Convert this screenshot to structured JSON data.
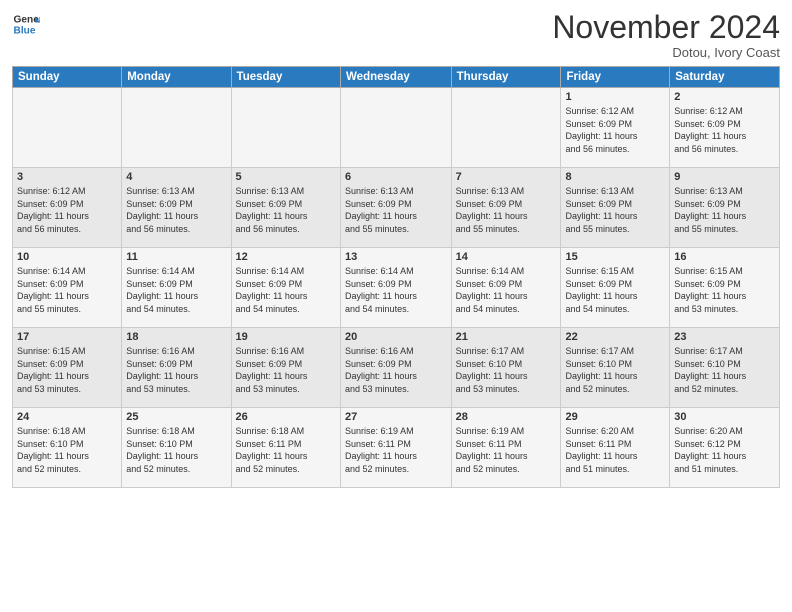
{
  "header": {
    "logo_line1": "General",
    "logo_line2": "Blue",
    "month_title": "November 2024",
    "location": "Dotou, Ivory Coast"
  },
  "weekdays": [
    "Sunday",
    "Monday",
    "Tuesday",
    "Wednesday",
    "Thursday",
    "Friday",
    "Saturday"
  ],
  "weeks": [
    [
      {
        "day": "",
        "info": ""
      },
      {
        "day": "",
        "info": ""
      },
      {
        "day": "",
        "info": ""
      },
      {
        "day": "",
        "info": ""
      },
      {
        "day": "",
        "info": ""
      },
      {
        "day": "1",
        "info": "Sunrise: 6:12 AM\nSunset: 6:09 PM\nDaylight: 11 hours\nand 56 minutes."
      },
      {
        "day": "2",
        "info": "Sunrise: 6:12 AM\nSunset: 6:09 PM\nDaylight: 11 hours\nand 56 minutes."
      }
    ],
    [
      {
        "day": "3",
        "info": "Sunrise: 6:12 AM\nSunset: 6:09 PM\nDaylight: 11 hours\nand 56 minutes."
      },
      {
        "day": "4",
        "info": "Sunrise: 6:13 AM\nSunset: 6:09 PM\nDaylight: 11 hours\nand 56 minutes."
      },
      {
        "day": "5",
        "info": "Sunrise: 6:13 AM\nSunset: 6:09 PM\nDaylight: 11 hours\nand 56 minutes."
      },
      {
        "day": "6",
        "info": "Sunrise: 6:13 AM\nSunset: 6:09 PM\nDaylight: 11 hours\nand 55 minutes."
      },
      {
        "day": "7",
        "info": "Sunrise: 6:13 AM\nSunset: 6:09 PM\nDaylight: 11 hours\nand 55 minutes."
      },
      {
        "day": "8",
        "info": "Sunrise: 6:13 AM\nSunset: 6:09 PM\nDaylight: 11 hours\nand 55 minutes."
      },
      {
        "day": "9",
        "info": "Sunrise: 6:13 AM\nSunset: 6:09 PM\nDaylight: 11 hours\nand 55 minutes."
      }
    ],
    [
      {
        "day": "10",
        "info": "Sunrise: 6:14 AM\nSunset: 6:09 PM\nDaylight: 11 hours\nand 55 minutes."
      },
      {
        "day": "11",
        "info": "Sunrise: 6:14 AM\nSunset: 6:09 PM\nDaylight: 11 hours\nand 54 minutes."
      },
      {
        "day": "12",
        "info": "Sunrise: 6:14 AM\nSunset: 6:09 PM\nDaylight: 11 hours\nand 54 minutes."
      },
      {
        "day": "13",
        "info": "Sunrise: 6:14 AM\nSunset: 6:09 PM\nDaylight: 11 hours\nand 54 minutes."
      },
      {
        "day": "14",
        "info": "Sunrise: 6:14 AM\nSunset: 6:09 PM\nDaylight: 11 hours\nand 54 minutes."
      },
      {
        "day": "15",
        "info": "Sunrise: 6:15 AM\nSunset: 6:09 PM\nDaylight: 11 hours\nand 54 minutes."
      },
      {
        "day": "16",
        "info": "Sunrise: 6:15 AM\nSunset: 6:09 PM\nDaylight: 11 hours\nand 53 minutes."
      }
    ],
    [
      {
        "day": "17",
        "info": "Sunrise: 6:15 AM\nSunset: 6:09 PM\nDaylight: 11 hours\nand 53 minutes."
      },
      {
        "day": "18",
        "info": "Sunrise: 6:16 AM\nSunset: 6:09 PM\nDaylight: 11 hours\nand 53 minutes."
      },
      {
        "day": "19",
        "info": "Sunrise: 6:16 AM\nSunset: 6:09 PM\nDaylight: 11 hours\nand 53 minutes."
      },
      {
        "day": "20",
        "info": "Sunrise: 6:16 AM\nSunset: 6:09 PM\nDaylight: 11 hours\nand 53 minutes."
      },
      {
        "day": "21",
        "info": "Sunrise: 6:17 AM\nSunset: 6:10 PM\nDaylight: 11 hours\nand 53 minutes."
      },
      {
        "day": "22",
        "info": "Sunrise: 6:17 AM\nSunset: 6:10 PM\nDaylight: 11 hours\nand 52 minutes."
      },
      {
        "day": "23",
        "info": "Sunrise: 6:17 AM\nSunset: 6:10 PM\nDaylight: 11 hours\nand 52 minutes."
      }
    ],
    [
      {
        "day": "24",
        "info": "Sunrise: 6:18 AM\nSunset: 6:10 PM\nDaylight: 11 hours\nand 52 minutes."
      },
      {
        "day": "25",
        "info": "Sunrise: 6:18 AM\nSunset: 6:10 PM\nDaylight: 11 hours\nand 52 minutes."
      },
      {
        "day": "26",
        "info": "Sunrise: 6:18 AM\nSunset: 6:11 PM\nDaylight: 11 hours\nand 52 minutes."
      },
      {
        "day": "27",
        "info": "Sunrise: 6:19 AM\nSunset: 6:11 PM\nDaylight: 11 hours\nand 52 minutes."
      },
      {
        "day": "28",
        "info": "Sunrise: 6:19 AM\nSunset: 6:11 PM\nDaylight: 11 hours\nand 52 minutes."
      },
      {
        "day": "29",
        "info": "Sunrise: 6:20 AM\nSunset: 6:11 PM\nDaylight: 11 hours\nand 51 minutes."
      },
      {
        "day": "30",
        "info": "Sunrise: 6:20 AM\nSunset: 6:12 PM\nDaylight: 11 hours\nand 51 minutes."
      }
    ]
  ]
}
